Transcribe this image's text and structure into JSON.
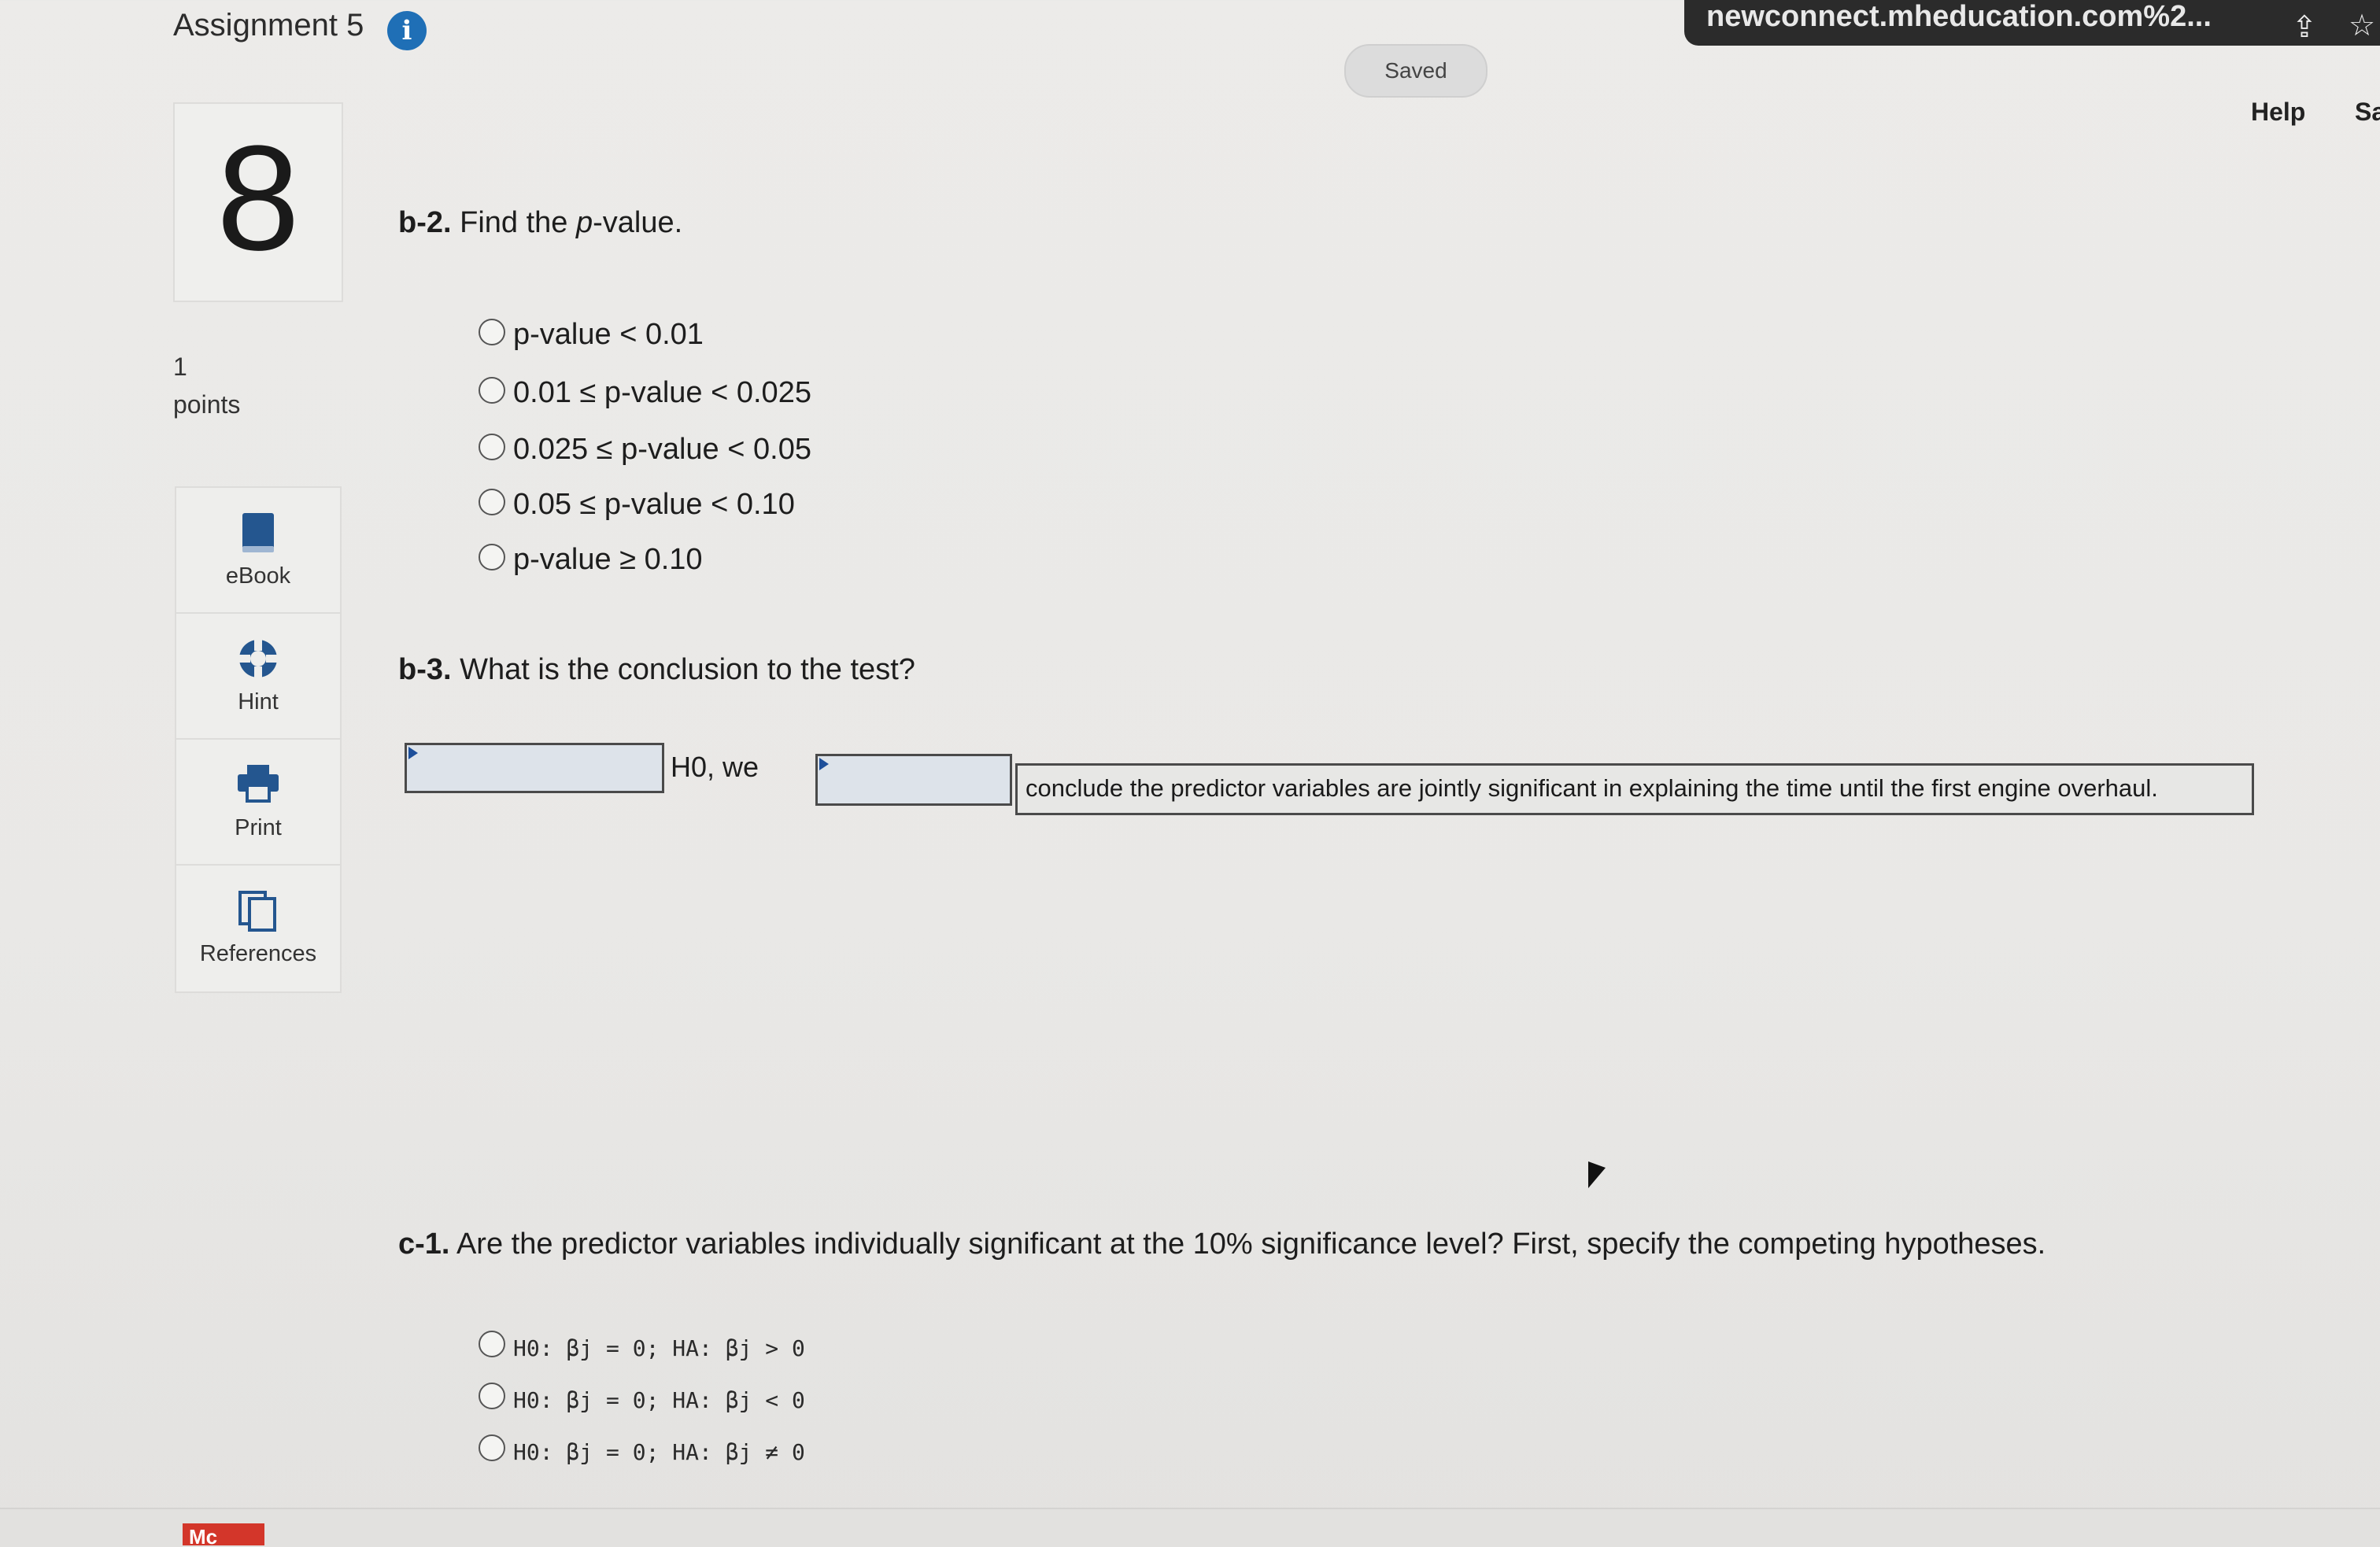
{
  "header": {
    "assignment_title": "Assignment 5",
    "info_icon": "info-icon",
    "url": "newconnect.mheducation.com%2...",
    "saved_label": "Saved",
    "help_label": "Help",
    "save_exit_label": "Sa"
  },
  "question": {
    "number": "8",
    "points_value": "1",
    "points_label": "points"
  },
  "tools": [
    {
      "label": "eBook",
      "icon": "book-icon"
    },
    {
      "label": "Hint",
      "icon": "lifebuoy-icon"
    },
    {
      "label": "Print",
      "icon": "printer-icon"
    },
    {
      "label": "References",
      "icon": "documents-icon"
    }
  ],
  "b2": {
    "prefix": "b-2.",
    "text_before": "Find the ",
    "italic": "p",
    "text_after": "-value.",
    "options": [
      "p-value < 0.01",
      "0.01 ≤ p-value < 0.025",
      "0.025 ≤ p-value < 0.05",
      "0.05 ≤ p-value < 0.10",
      "p-value ≥ 0.10"
    ]
  },
  "b3": {
    "prefix": "b-3.",
    "text": "What is the conclusion to the test?",
    "dropdown_1_value": "",
    "h0_label": "H0, we",
    "dropdown_2_value": "",
    "conclusion_text": "conclude the predictor variables are jointly significant in explaining the time until the first engine overhaul."
  },
  "c1": {
    "prefix": "c-1.",
    "text": "Are the predictor variables individually significant at the 10% significance level? First, specify the competing hypotheses.",
    "options": [
      "H0: βj = 0; HA: βj > 0",
      "H0: βj = 0; HA: βj < 0",
      "H0: βj = 0; HA: βj ≠ 0"
    ]
  },
  "footer": {
    "logo_text": "Mc"
  },
  "colors": {
    "accent": "#1f6fb6",
    "dropdown_fill": "#dde3ea",
    "logo_red": "#d3362a"
  }
}
